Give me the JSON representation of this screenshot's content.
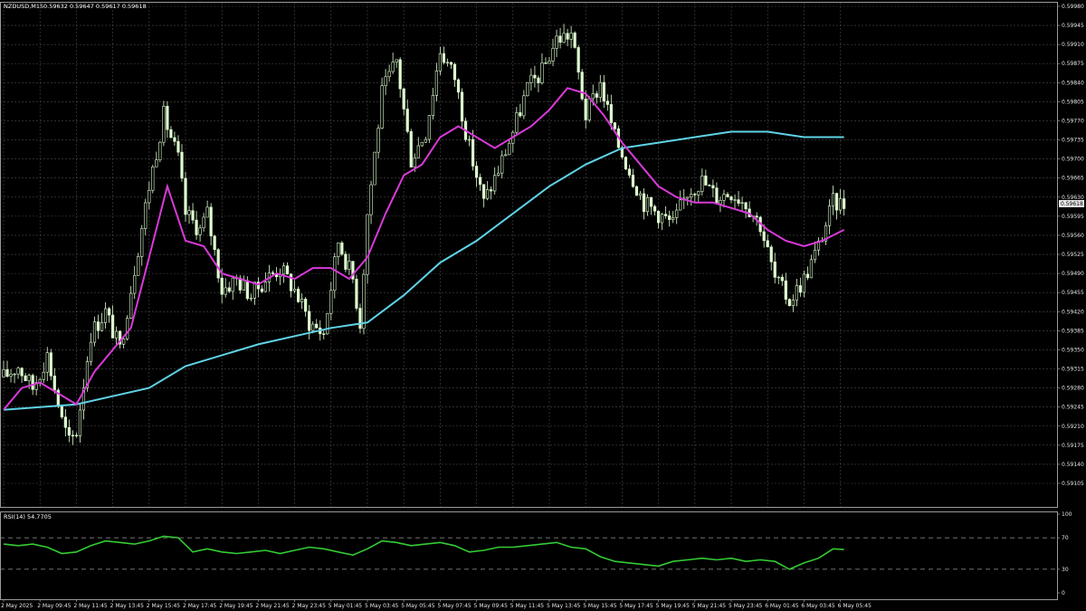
{
  "header": {
    "symbol": "NZDUSD,M15",
    "ohlc": "0.59632 0.59647 0.59617 0.59618"
  },
  "rsi_header": "RSI(14) 54.7705",
  "current_price_label": "0.59618",
  "colors": {
    "background": "#000000",
    "grid": "#4a4a4a",
    "candle": "#dfffd0",
    "fast_ma": "#d83ad8",
    "slow_ma": "#5fd3e6",
    "rsi": "#33cc33",
    "axis_text": "#e6e6e6"
  },
  "chart_data": [
    {
      "type": "candlestick",
      "symbol": "NZDUSD",
      "timeframe": "M15",
      "ylim": [
        0.59105,
        0.5998
      ],
      "y_tick_labels": [
        "0.59980",
        "0.59945",
        "0.59910",
        "0.59875",
        "0.59840",
        "0.59805",
        "0.59770",
        "0.59735",
        "0.59700",
        "0.59665",
        "0.59630",
        "0.59595",
        "0.59560",
        "0.59525",
        "0.59490",
        "0.59455",
        "0.59420",
        "0.59385",
        "0.59350",
        "0.59315",
        "0.59280",
        "0.59245",
        "0.59210",
        "0.59175",
        "0.59140",
        "0.59105"
      ],
      "x_tick_labels": [
        "2 May 2025",
        "2 May 09:45",
        "2 May 11:45",
        "2 May 13:45",
        "2 May 15:45",
        "2 May 17:45",
        "2 May 19:45",
        "2 May 21:45",
        "2 May 23:45",
        "5 May 01:45",
        "5 May 03:45",
        "5 May 05:45",
        "5 May 07:45",
        "5 May 09:45",
        "5 May 11:45",
        "5 May 13:45",
        "5 May 15:45",
        "5 May 17:45",
        "5 May 19:45",
        "5 May 21:45",
        "5 May 23:45",
        "6 May 01:45",
        "6 May 03:45",
        "6 May 05:45"
      ],
      "x_tick_bar_index": [
        0,
        10,
        20,
        30,
        40,
        50,
        60,
        70,
        80,
        90,
        100,
        110,
        120,
        130,
        140,
        150,
        160,
        170,
        180,
        190,
        200,
        210,
        220,
        230
      ],
      "candle_close_path": [
        [
          0,
          0.593
        ],
        [
          4,
          0.5932
        ],
        [
          8,
          0.5928
        ],
        [
          12,
          0.5934
        ],
        [
          16,
          0.5922
        ],
        [
          18,
          0.5918
        ],
        [
          20,
          0.592
        ],
        [
          24,
          0.5938
        ],
        [
          28,
          0.5942
        ],
        [
          32,
          0.5935
        ],
        [
          36,
          0.595
        ],
        [
          40,
          0.5965
        ],
        [
          44,
          0.5978
        ],
        [
          48,
          0.597
        ],
        [
          50,
          0.596
        ],
        [
          54,
          0.5957
        ],
        [
          56,
          0.596
        ],
        [
          60,
          0.5946
        ],
        [
          64,
          0.5948
        ],
        [
          68,
          0.5945
        ],
        [
          72,
          0.5948
        ],
        [
          76,
          0.595
        ],
        [
          80,
          0.5946
        ],
        [
          84,
          0.594
        ],
        [
          88,
          0.5938
        ],
        [
          92,
          0.5955
        ],
        [
          96,
          0.5948
        ],
        [
          98,
          0.594
        ],
        [
          100,
          0.596
        ],
        [
          104,
          0.5982
        ],
        [
          108,
          0.5988
        ],
        [
          112,
          0.597
        ],
        [
          116,
          0.5975
        ],
        [
          120,
          0.599
        ],
        [
          124,
          0.5985
        ],
        [
          128,
          0.5972
        ],
        [
          132,
          0.5962
        ],
        [
          136,
          0.5968
        ],
        [
          140,
          0.5975
        ],
        [
          144,
          0.5983
        ],
        [
          148,
          0.5986
        ],
        [
          152,
          0.5992
        ],
        [
          156,
          0.5993
        ],
        [
          160,
          0.5978
        ],
        [
          164,
          0.5984
        ],
        [
          168,
          0.5974
        ],
        [
          172,
          0.5968
        ],
        [
          176,
          0.5962
        ],
        [
          180,
          0.596
        ],
        [
          184,
          0.5958
        ],
        [
          188,
          0.5964
        ],
        [
          192,
          0.5966
        ],
        [
          196,
          0.5963
        ],
        [
          200,
          0.5964
        ],
        [
          204,
          0.5962
        ],
        [
          208,
          0.5958
        ],
        [
          212,
          0.5948
        ],
        [
          216,
          0.5944
        ],
        [
          220,
          0.5948
        ],
        [
          224,
          0.5954
        ],
        [
          228,
          0.5962
        ],
        [
          231,
          0.59618
        ]
      ],
      "fast_ma": [
        [
          0,
          0.5924
        ],
        [
          5,
          0.5928
        ],
        [
          10,
          0.5929
        ],
        [
          15,
          0.5927
        ],
        [
          20,
          0.5925
        ],
        [
          25,
          0.5931
        ],
        [
          30,
          0.5935
        ],
        [
          35,
          0.5939
        ],
        [
          40,
          0.5952
        ],
        [
          45,
          0.5965
        ],
        [
          50,
          0.5955
        ],
        [
          55,
          0.5954
        ],
        [
          60,
          0.5949
        ],
        [
          65,
          0.5948
        ],
        [
          70,
          0.5947
        ],
        [
          75,
          0.5949
        ],
        [
          80,
          0.5948
        ],
        [
          85,
          0.595
        ],
        [
          90,
          0.595
        ],
        [
          95,
          0.5948
        ],
        [
          100,
          0.5952
        ],
        [
          105,
          0.596
        ],
        [
          110,
          0.5967
        ],
        [
          115,
          0.5969
        ],
        [
          120,
          0.5974
        ],
        [
          125,
          0.5976
        ],
        [
          130,
          0.5974
        ],
        [
          135,
          0.5972
        ],
        [
          140,
          0.5974
        ],
        [
          145,
          0.5976
        ],
        [
          150,
          0.5979
        ],
        [
          155,
          0.5983
        ],
        [
          160,
          0.5982
        ],
        [
          165,
          0.5978
        ],
        [
          170,
          0.5973
        ],
        [
          175,
          0.5969
        ],
        [
          180,
          0.5965
        ],
        [
          185,
          0.5963
        ],
        [
          190,
          0.5962
        ],
        [
          195,
          0.5962
        ],
        [
          200,
          0.5961
        ],
        [
          205,
          0.596
        ],
        [
          210,
          0.5957
        ],
        [
          215,
          0.5955
        ],
        [
          220,
          0.5954
        ],
        [
          225,
          0.5955
        ],
        [
          231,
          0.5957
        ]
      ],
      "slow_ma": [
        [
          0,
          0.5924
        ],
        [
          20,
          0.5925
        ],
        [
          40,
          0.5928
        ],
        [
          50,
          0.5932
        ],
        [
          70,
          0.5936
        ],
        [
          90,
          0.5939
        ],
        [
          100,
          0.594
        ],
        [
          110,
          0.5945
        ],
        [
          120,
          0.5951
        ],
        [
          130,
          0.5955
        ],
        [
          140,
          0.596
        ],
        [
          150,
          0.5965
        ],
        [
          160,
          0.5969
        ],
        [
          170,
          0.5972
        ],
        [
          180,
          0.5973
        ],
        [
          190,
          0.5974
        ],
        [
          200,
          0.5975
        ],
        [
          210,
          0.5975
        ],
        [
          220,
          0.5974
        ],
        [
          231,
          0.5974
        ]
      ]
    },
    {
      "type": "line",
      "indicator": "RSI(14)",
      "ylim": [
        0,
        100
      ],
      "y_tick_labels": [
        "100",
        "70",
        "30",
        "0"
      ],
      "levels": [
        70,
        30
      ],
      "x": [
        0,
        4,
        8,
        12,
        16,
        20,
        24,
        28,
        32,
        36,
        40,
        44,
        48,
        52,
        56,
        60,
        64,
        68,
        72,
        76,
        80,
        84,
        88,
        92,
        96,
        100,
        104,
        108,
        112,
        116,
        120,
        124,
        128,
        132,
        136,
        140,
        144,
        148,
        152,
        156,
        160,
        164,
        168,
        172,
        176,
        180,
        184,
        188,
        192,
        196,
        200,
        204,
        208,
        212,
        216,
        220,
        224,
        228,
        231
      ],
      "values": [
        62,
        60,
        62,
        58,
        50,
        52,
        60,
        66,
        64,
        62,
        66,
        72,
        70,
        52,
        56,
        52,
        50,
        52,
        54,
        50,
        54,
        58,
        56,
        52,
        48,
        56,
        66,
        64,
        60,
        62,
        64,
        60,
        52,
        54,
        58,
        58,
        60,
        62,
        64,
        58,
        56,
        46,
        40,
        38,
        36,
        34,
        40,
        42,
        44,
        42,
        44,
        40,
        42,
        40,
        30,
        38,
        44,
        56,
        55
      ]
    }
  ]
}
